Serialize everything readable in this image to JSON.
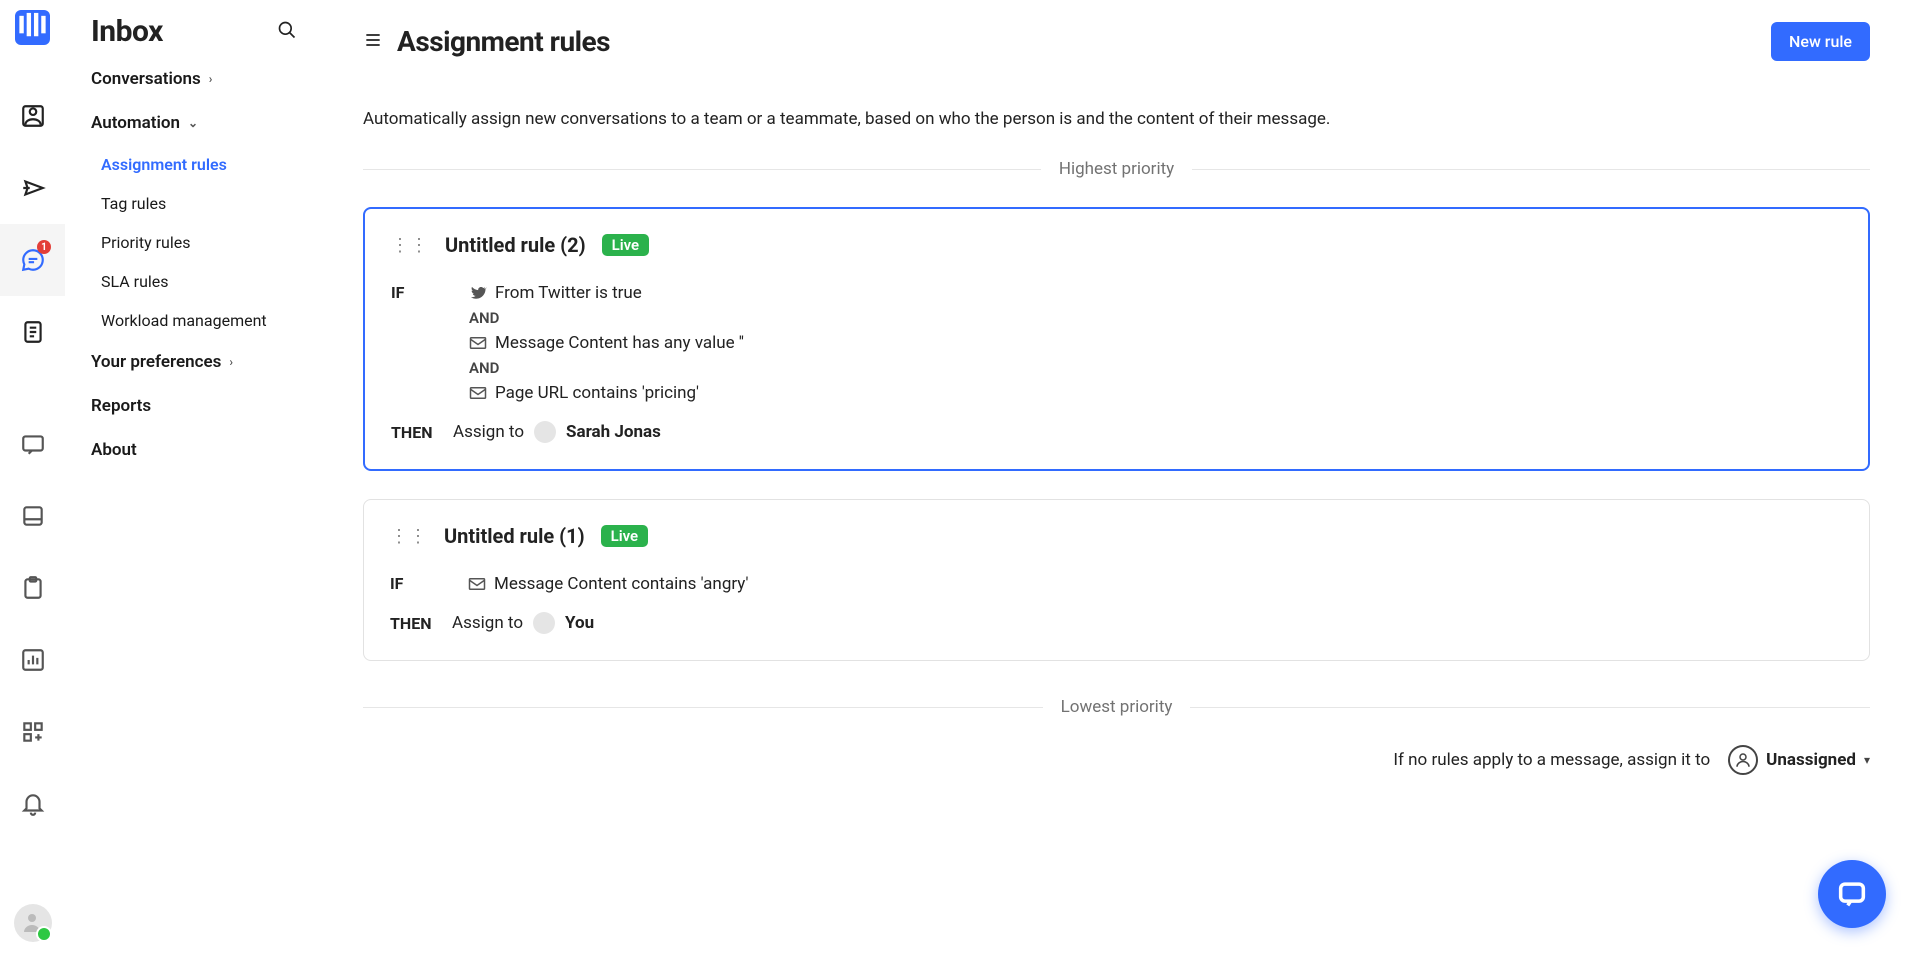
{
  "sidebar": {
    "title": "Inbox",
    "sections": {
      "conversations": "Conversations",
      "automation": "Automation",
      "preferences": "Your preferences",
      "reports": "Reports",
      "about": "About"
    },
    "automation_items": [
      "Assignment rules",
      "Tag rules",
      "Priority rules",
      "SLA rules",
      "Workload management"
    ],
    "badge_count": "1"
  },
  "page": {
    "title": "Assignment rules",
    "new_rule": "New rule",
    "description": "Automatically assign new conversations to a team or a teammate, based on who the person is and the content of their message.",
    "highest": "Highest priority",
    "lowest": "Lowest priority"
  },
  "rules": [
    {
      "title": "Untitled rule (2)",
      "status": "Live",
      "if_label": "IF",
      "then_label": "THEN",
      "and": "AND",
      "conditions": [
        {
          "icon": "twitter",
          "text": "From Twitter is true"
        },
        {
          "icon": "mail",
          "text": "Message Content has any value ''"
        },
        {
          "icon": "mail",
          "text": "Page URL contains 'pricing'"
        }
      ],
      "assign_label": "Assign to",
      "assignee": "Sarah Jonas"
    },
    {
      "title": "Untitled rule (1)",
      "status": "Live",
      "if_label": "IF",
      "then_label": "THEN",
      "conditions": [
        {
          "icon": "mail",
          "text": "Message Content contains 'angry'"
        }
      ],
      "assign_label": "Assign to",
      "assignee": "You"
    }
  ],
  "fallback": {
    "text": "If no rules apply to a message, assign it to",
    "value": "Unassigned"
  }
}
